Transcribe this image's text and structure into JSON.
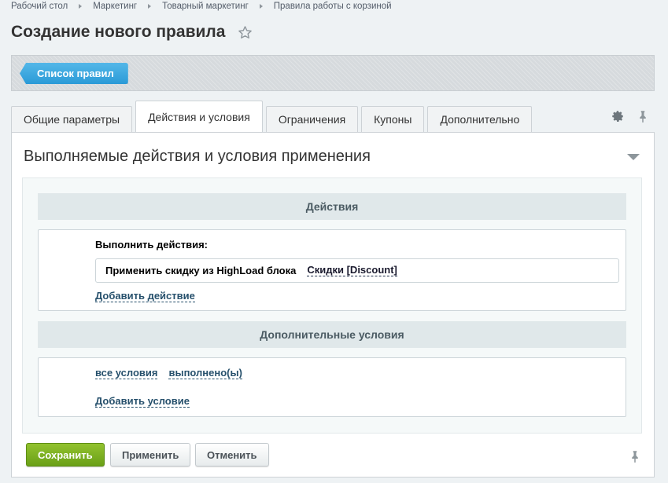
{
  "breadcrumb": [
    "Рабочий стол",
    "Маркетинг",
    "Товарный маркетинг",
    "Правила работы с корзиной"
  ],
  "title": "Создание нового правила",
  "toolbar": {
    "list_button": "Список правил"
  },
  "tabs": [
    {
      "label": "Общие параметры",
      "active": false
    },
    {
      "label": "Действия и условия",
      "active": true
    },
    {
      "label": "Ограничения",
      "active": false
    },
    {
      "label": "Купоны",
      "active": false
    },
    {
      "label": "Дополнительно",
      "active": false
    }
  ],
  "section": {
    "title": "Выполняемые действия и условия применения",
    "actions": {
      "header": "Действия",
      "label": "Выполнить действия:",
      "row_text": "Применить скидку из HighLoad блока",
      "row_value": "Скидки [Discount]",
      "add_link": "Добавить действие"
    },
    "conditions": {
      "header": "Дополнительные условия",
      "scope": "все условия",
      "state": "выполнено(ы)",
      "add_link": "Добавить условие"
    }
  },
  "footer": {
    "save": "Сохранить",
    "apply": "Применить",
    "cancel": "Отменить"
  },
  "colors": {
    "accent_blue": "#2a9ad7",
    "save_green": "#6aa017",
    "link": "#26506c"
  }
}
